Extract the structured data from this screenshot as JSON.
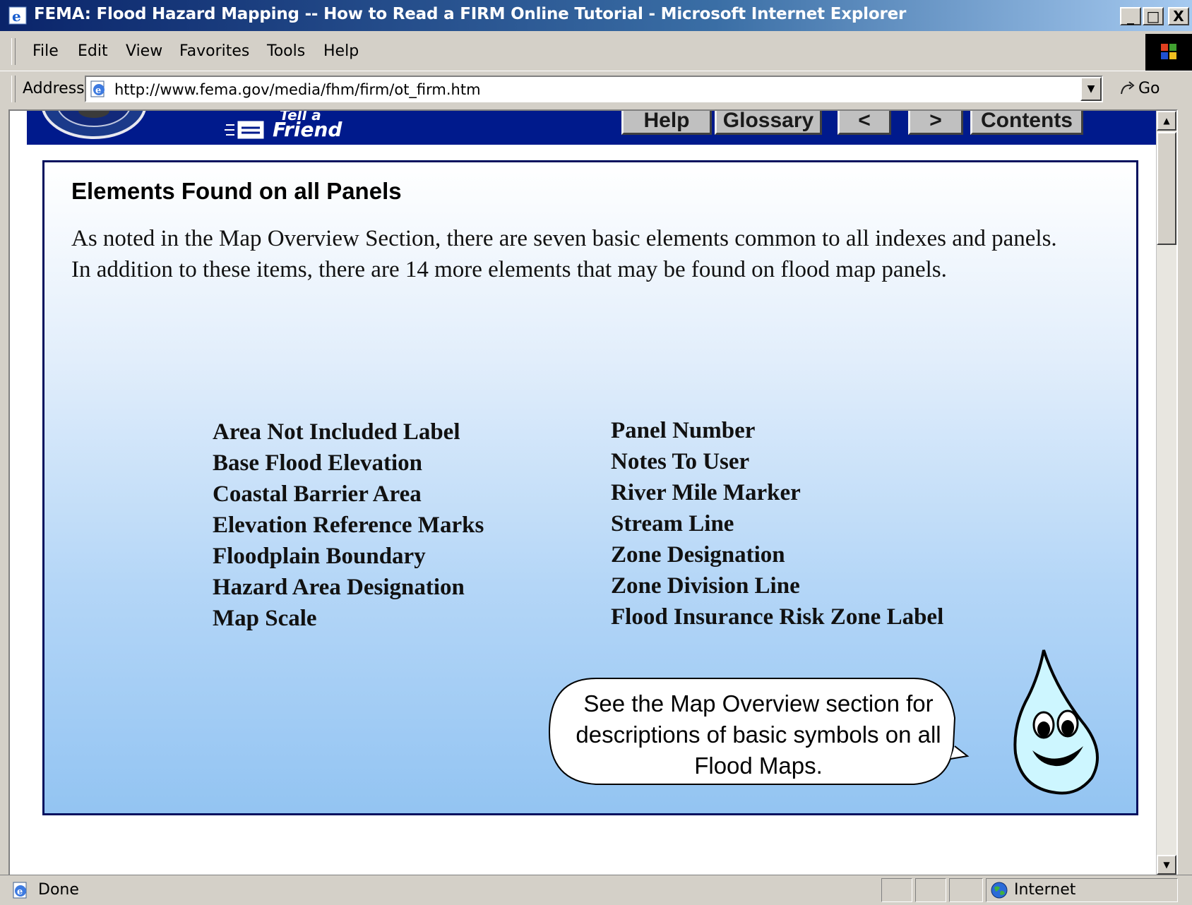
{
  "window": {
    "title": "FEMA: Flood Hazard Mapping -- How to Read a FIRM Online Tutorial - Microsoft Internet Explorer",
    "minimize": "_",
    "maximize": "□",
    "close": "X"
  },
  "menu": {
    "items": [
      "File",
      "Edit",
      "View",
      "Favorites",
      "Tools",
      "Help"
    ]
  },
  "address": {
    "label": "Address",
    "url": "http://www.fema.gov/media/fhm/firm/ot_firm.htm",
    "go": "Go"
  },
  "nav": {
    "tell_line1": "Tell a",
    "tell_line2": "Friend",
    "buttons": [
      "Help",
      "Glossary",
      "<",
      ">",
      "Contents"
    ]
  },
  "content": {
    "heading": "Elements Found on all Panels",
    "paragraph": "As noted in the Map Overview Section, there are seven basic elements common to all indexes and panels. In addition to these items, there are 14 more elements that may be found on flood map panels.",
    "left_column": [
      "Area Not Included Label",
      "Base Flood Elevation",
      "Coastal Barrier Area",
      "Elevation Reference Marks",
      "Floodplain Boundary",
      "Hazard Area Designation",
      "Map Scale"
    ],
    "right_column": [
      "Panel Number",
      "Notes To User",
      "River Mile Marker",
      "Stream Line",
      "Zone Designation",
      "Zone Division Line",
      "Flood Insurance Risk Zone Label"
    ],
    "bubble": "See the Map Overview section for descriptions of basic symbols on all Flood Maps."
  },
  "status": {
    "text": "Done",
    "zone": "Internet"
  },
  "colors": {
    "banner": "#001a8c",
    "panel_border": "#00105e",
    "drop_fill": "#cdf6ff"
  },
  "icons": [
    "ie-icon",
    "page-icon",
    "go-arrow-icon",
    "windows-logo-icon",
    "globe-icon",
    "fema-seal-icon",
    "water-drop-mascot-icon"
  ]
}
